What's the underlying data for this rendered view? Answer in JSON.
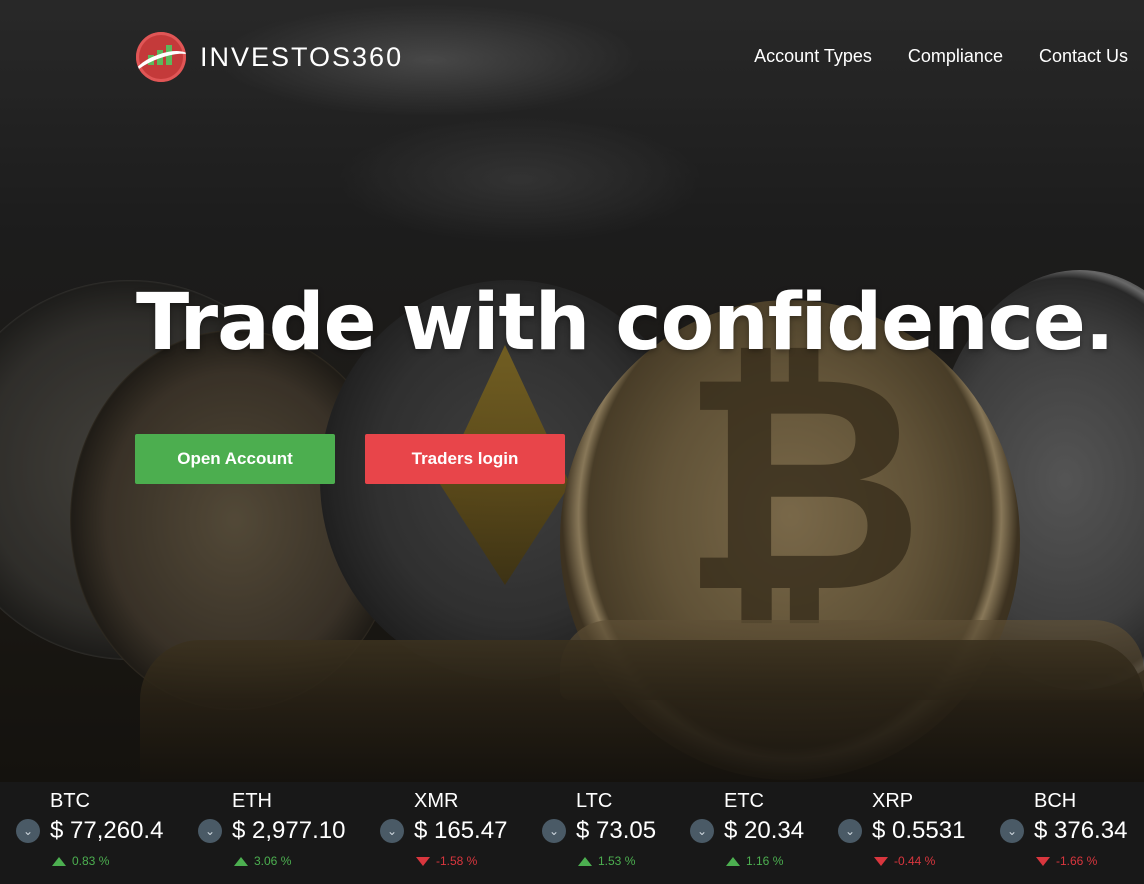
{
  "brand": {
    "name": "INVESTOS360"
  },
  "nav": {
    "items": [
      "Account Types",
      "Compliance",
      "Contact Us"
    ]
  },
  "hero": {
    "headline": "Trade with confidence.",
    "open_account": "Open Account",
    "traders_login": "Traders login"
  },
  "colors": {
    "green": "#4cae4f",
    "red": "#e8454a",
    "ticker_bg": "#181818"
  },
  "ticker": [
    {
      "symbol": "BTC",
      "price": "$ 77,260.4",
      "change": "0.83 %",
      "direction": "up"
    },
    {
      "symbol": "ETH",
      "price": "$ 2,977.10",
      "change": "3.06 %",
      "direction": "up"
    },
    {
      "symbol": "XMR",
      "price": "$ 165.47",
      "change": "-1.58 %",
      "direction": "down"
    },
    {
      "symbol": "LTC",
      "price": "$ 73.05",
      "change": "1.53 %",
      "direction": "up"
    },
    {
      "symbol": "ETC",
      "price": "$ 20.34",
      "change": "1.16 %",
      "direction": "up"
    },
    {
      "symbol": "XRP",
      "price": "$ 0.5531",
      "change": "-0.44 %",
      "direction": "down"
    },
    {
      "symbol": "BCH",
      "price": "$ 376.34",
      "change": "-1.66 %",
      "direction": "down"
    }
  ],
  "icons": {
    "ticker_dropdown": "chevron-down-icon",
    "logo": "chart-bars-icon"
  }
}
